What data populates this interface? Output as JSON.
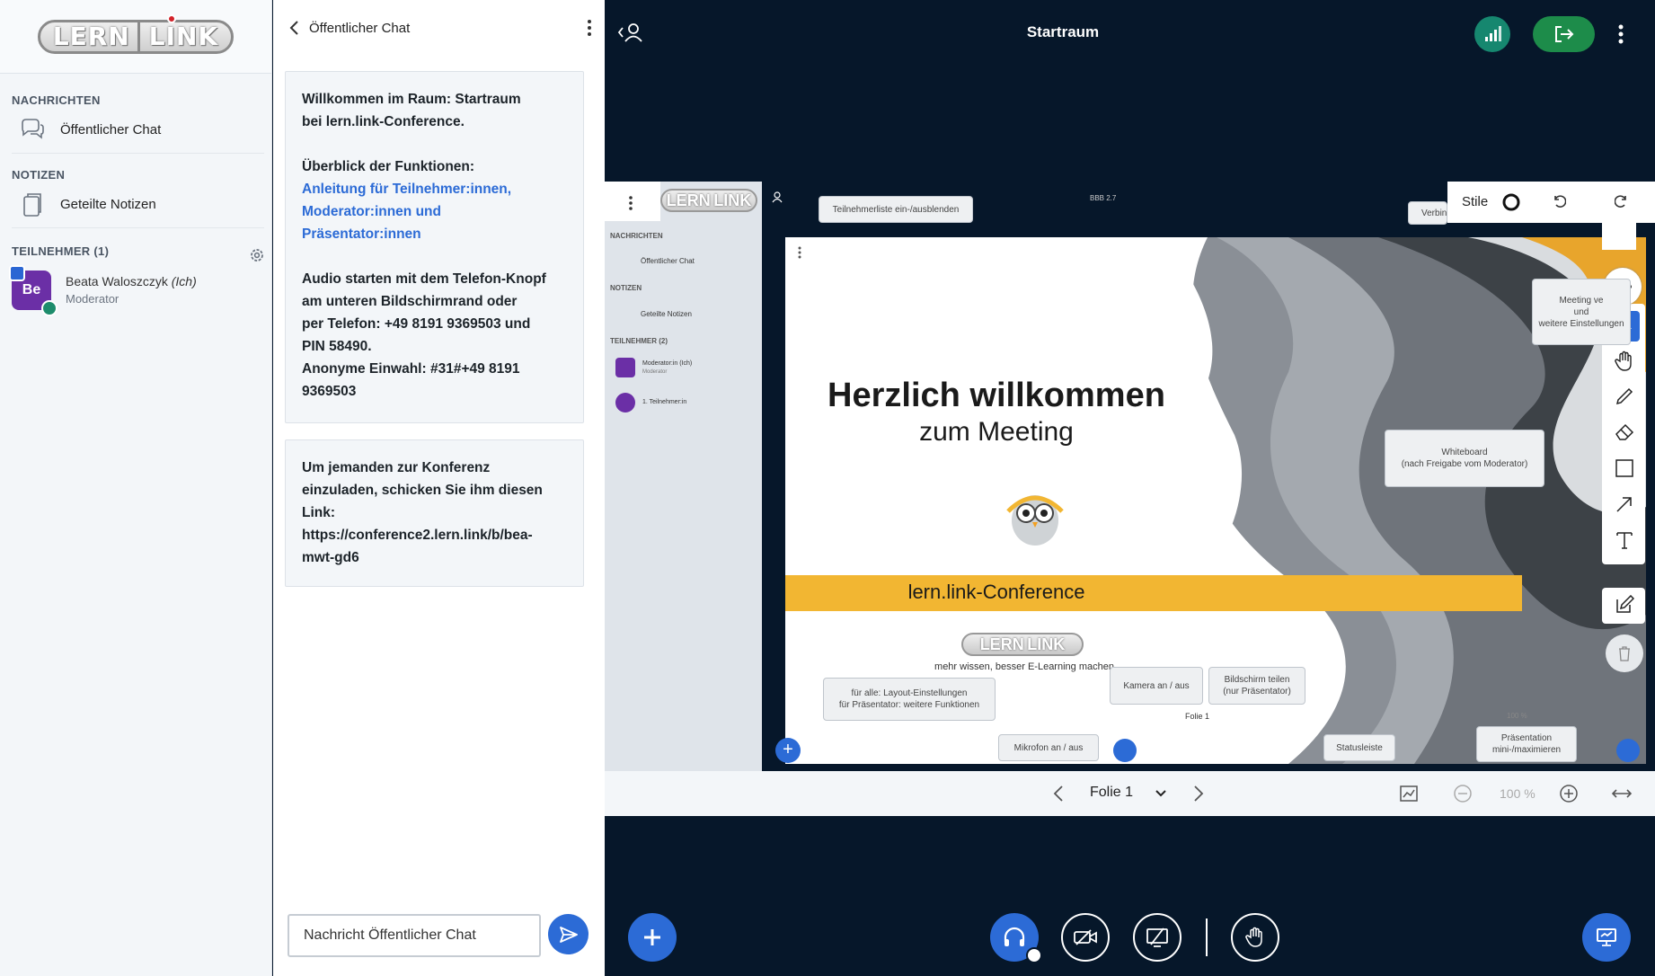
{
  "sidebar": {
    "logo_left": "LERN",
    "logo_right": "LINK",
    "messages_heading": "NACHRICHTEN",
    "public_chat": "Öffentlicher Chat",
    "notes_heading": "NOTIZEN",
    "shared_notes": "Geteilte Notizen",
    "participants_heading": "TEILNEHMER (1)",
    "user": {
      "initials": "Be",
      "name": "Beata Waloszczyk",
      "self_tag": "(Ich)",
      "role": "Moderator"
    }
  },
  "chat": {
    "title": "Öffentlicher Chat",
    "welcome_line1": "Willkommen im Raum: Startraum",
    "welcome_line2": "bei lern.link-Conference.",
    "overview": "Überblick der Funktionen:",
    "guide_link1": "Anleitung für Teilnehmer:innen,",
    "guide_link2": "Moderator:innen und",
    "guide_link3": "Präsentator:innen",
    "audio1": "Audio starten mit dem Telefon-Knopf",
    "audio2": "am unteren Bildschirmrand oder",
    "audio3": "per Telefon: +49 8191 9369503 und",
    "audio4": "PIN 58490.",
    "audio5": "Anonyme Einwahl: #31#+49 8191",
    "audio6": "9369503",
    "invite1": "Um jemanden zur Konferenz",
    "invite2": "einzuladen, schicken Sie ihm diesen",
    "invite3": "Link:",
    "invite4": "https://conference2.lern.link/b/bea-",
    "invite5": "mwt-gd6",
    "input_placeholder": "Nachricht Öffentlicher Chat"
  },
  "main": {
    "room_title": "Startraum",
    "colors": {
      "green": "#1d8c4a",
      "teal": "#16876f",
      "blue": "#2c6bd6",
      "navy": "#06172a"
    }
  },
  "slide": {
    "heading": "Herzlich willkommen",
    "subheading": "zum Meeting",
    "banner": "lern.link-Conference",
    "tagline": "mehr wissen, besser E-Learning machen",
    "logo_left": "LERN",
    "logo_right": "LINK",
    "version": "BBB 2.7",
    "mini_nachrichten": "NACHRICHTEN",
    "mini_chat": "Öffentlicher Chat",
    "mini_notizen": "NOTIZEN",
    "mini_notes": "Geteilte Notizen",
    "mini_teilnehmer": "TEILNEHMER (2)",
    "mini_user1": "Moderator:in (Ich)",
    "mini_user1_role": "Moderator",
    "mini_user2": "1. Teilnehmer:in",
    "mini_stile": "Stile",
    "mini_folie": "Folie 1",
    "mini_zoom": "100 %",
    "tip_teilnehmer": "Teilnehmerliste ein-/ausblenden",
    "tip_verbindung": "Verbin",
    "tip_meeting1": "Meeting ve",
    "tip_meeting2": "und",
    "tip_meeting3": "weitere Einstellungen",
    "tip_whiteboard1": "Whiteboard",
    "tip_whiteboard2": "(nach Freigabe vom Moderator)",
    "tip_layout1": "für alle: Layout-Einstellungen",
    "tip_layout2": "für Präsentator: weitere Funktionen",
    "tip_kamera": "Kamera an / aus",
    "tip_bildschirm1": "Bildschirm teilen",
    "tip_bildschirm2": "(nur Präsentator)",
    "tip_mikrofon": "Mikrofon an / aus",
    "tip_status": "Statusleiste",
    "tip_praesentation1": "Präsentation",
    "tip_praesentation2": "mini-/maximieren"
  },
  "whiteboard": {
    "styles_label": "Stile"
  },
  "pres_bar": {
    "slide_label": "Folie 1",
    "zoom": "100 %"
  }
}
